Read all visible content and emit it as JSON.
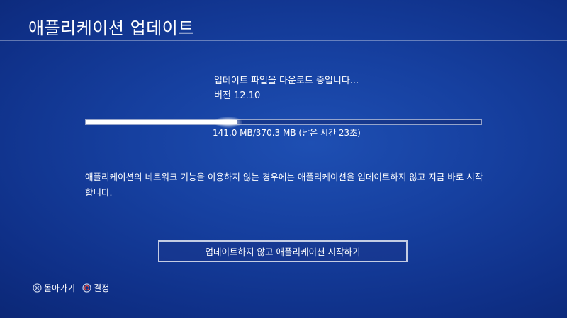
{
  "header": {
    "title": "애플리케이션 업데이트"
  },
  "download": {
    "status": "업데이트 파일을 다운로드 중입니다...",
    "version": "버전 12.10",
    "progress_fraction": 0.381,
    "progress_text": "141.0 MB/370.3 MB (남은 시간 23초)"
  },
  "description": "애플리케이션의 네트워크 기능을 이용하지 않는 경우에는 애플리케이션을 업데이트하지 않고 지금 바로 시작합니다.",
  "actions": {
    "skip_button_label": "업데이트하지 않고 애플리케이션 시작하기"
  },
  "footer": {
    "back_label": "돌아가기",
    "back_icon": "cross-button-icon",
    "confirm_label": "결정",
    "confirm_icon": "circle-button-icon"
  },
  "colors": {
    "background": "#1640a0",
    "progress_fill": "#ffffff",
    "circle_button": "#e0443a"
  }
}
